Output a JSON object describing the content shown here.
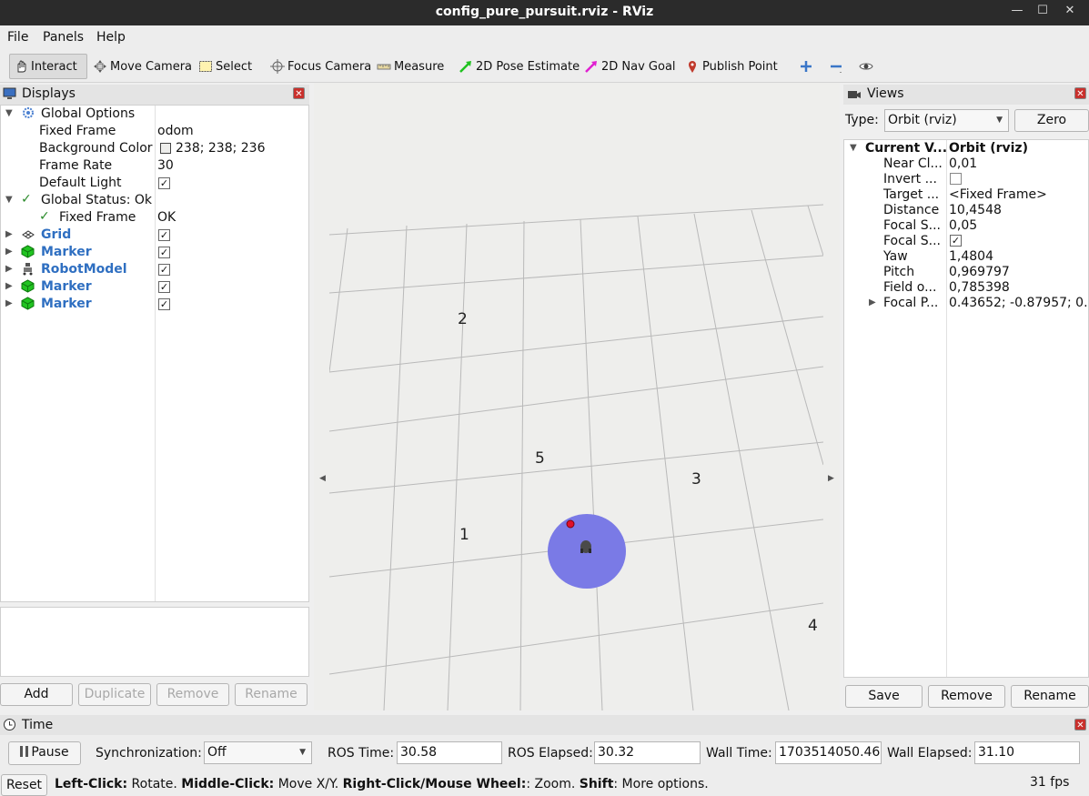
{
  "window": {
    "title": "config_pure_pursuit.rviz - RViz",
    "minimize": "—",
    "maximize": "☐",
    "close": "✕"
  },
  "menu": {
    "file": "File",
    "panels": "Panels",
    "help": "Help"
  },
  "toolbar": {
    "interact": "Interact",
    "move_camera": "Move Camera",
    "select": "Select",
    "focus_camera": "Focus Camera",
    "measure": "Measure",
    "pose_estimate": "2D Pose Estimate",
    "nav_goal": "2D Nav Goal",
    "publish_point": "Publish Point"
  },
  "displays": {
    "title": "Displays",
    "rows": [
      {
        "label": "Global Options",
        "value": ""
      },
      {
        "label": "Fixed Frame",
        "value": "odom"
      },
      {
        "label": "Background Color",
        "value": "238; 238; 236"
      },
      {
        "label": "Frame Rate",
        "value": "30"
      },
      {
        "label": "Default Light",
        "value": ""
      },
      {
        "label": "Global Status: Ok",
        "value": ""
      },
      {
        "label": "Fixed Frame",
        "value": "OK"
      },
      {
        "label": "Grid",
        "value": ""
      },
      {
        "label": "Marker",
        "value": ""
      },
      {
        "label": "RobotModel",
        "value": ""
      },
      {
        "label": "Marker",
        "value": ""
      },
      {
        "label": "Marker",
        "value": ""
      }
    ],
    "buttons": {
      "add": "Add",
      "duplicate": "Duplicate",
      "remove": "Remove",
      "rename": "Rename"
    }
  },
  "viewport": {
    "labels": [
      "2",
      "5",
      "3",
      "1",
      "4"
    ],
    "background_color": "#eeeeec",
    "robot_disc_color": "#7a7ae6",
    "goal_point_color": "#e0102a"
  },
  "views": {
    "title": "Views",
    "type_label": "Type:",
    "type_value": "Orbit (rviz)",
    "zero": "Zero",
    "rows": [
      {
        "label": "Current V...",
        "value": "Orbit (rviz)"
      },
      {
        "label": "Near Cl...",
        "value": "0,01"
      },
      {
        "label": "Invert ...",
        "value": ""
      },
      {
        "label": "Target ...",
        "value": "<Fixed Frame>"
      },
      {
        "label": "Distance",
        "value": "10,4548"
      },
      {
        "label": "Focal S...",
        "value": "0,05"
      },
      {
        "label": "Focal S...",
        "value": ""
      },
      {
        "label": "Yaw",
        "value": "1,4804"
      },
      {
        "label": "Pitch",
        "value": "0,969797"
      },
      {
        "label": "Field o...",
        "value": "0,785398"
      },
      {
        "label": "Focal P...",
        "value": "0.43652; -0.87957; 0..."
      }
    ],
    "buttons": {
      "save": "Save",
      "remove": "Remove",
      "rename": "Rename"
    }
  },
  "time": {
    "title": "Time",
    "pause": "Pause",
    "sync_label": "Synchronization:",
    "sync_value": "Off",
    "ros_time_label": "ROS Time:",
    "ros_time": "30.58",
    "ros_elapsed_label": "ROS Elapsed:",
    "ros_elapsed": "30.32",
    "wall_time_label": "Wall Time:",
    "wall_time": "1703514050.46",
    "wall_elapsed_label": "Wall Elapsed:",
    "wall_elapsed": "31.10"
  },
  "status": {
    "reset": "Reset",
    "left_click": "Left-Click:",
    "left_text": " Rotate. ",
    "middle_click": "Middle-Click:",
    "middle_text": " Move X/Y. ",
    "right_click": "Right-Click/Mouse Wheel:",
    "right_text": ": Zoom. ",
    "shift": "Shift",
    "shift_text": ": More options.",
    "fps": "31 fps"
  }
}
